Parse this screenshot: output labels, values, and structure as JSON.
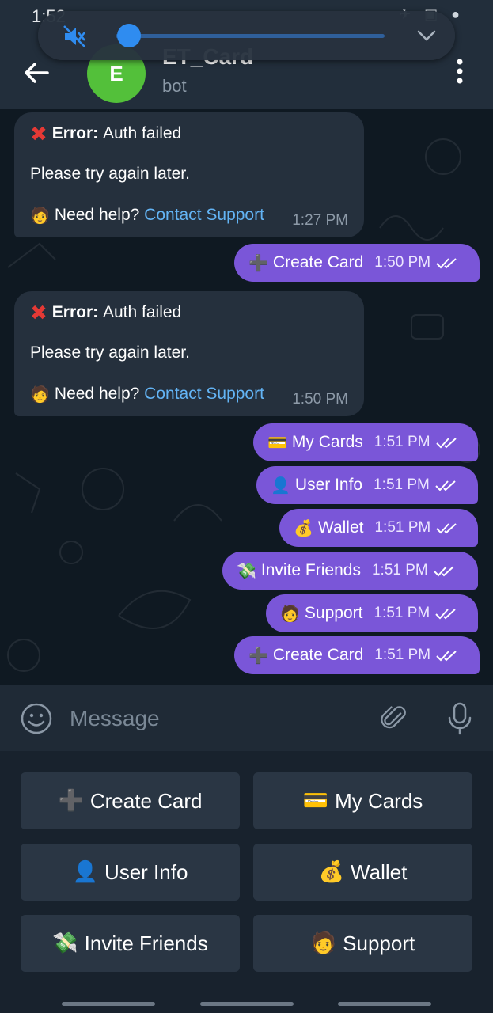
{
  "status_bar": {
    "time": "1:52",
    "icons": "✈ ▣ ●"
  },
  "volume": {
    "level": 0.05
  },
  "header": {
    "title": "ET_Card",
    "subtitle": "bot",
    "avatar_letter": "E"
  },
  "messages": {
    "incoming": [
      {
        "error_label": "Error:",
        "error_text": "Auth failed",
        "retry_text": "Please try again later.",
        "help_emoji": "🧑",
        "help_text": "Need help?",
        "link_text": "Contact Support",
        "time": "1:27 PM"
      },
      {
        "error_label": "Error:",
        "error_text": "Auth failed",
        "retry_text": "Please try again later.",
        "help_emoji": "🧑",
        "help_text": "Need help?",
        "link_text": "Contact Support",
        "time": "1:50 PM"
      }
    ],
    "outgoing": [
      {
        "emoji": "➕",
        "label": "Create Card",
        "time": "1:50 PM"
      },
      {
        "emoji": "💳",
        "label": "My Cards",
        "time": "1:51 PM"
      },
      {
        "emoji": "👤",
        "label": "User Info",
        "time": "1:51 PM"
      },
      {
        "emoji": "💰",
        "label": "Wallet",
        "time": "1:51 PM"
      },
      {
        "emoji": "💸",
        "label": "Invite Friends",
        "time": "1:51 PM"
      },
      {
        "emoji": "🧑",
        "label": "Support",
        "time": "1:51 PM"
      },
      {
        "emoji": "➕",
        "label": "Create Card",
        "time": "1:51 PM"
      }
    ]
  },
  "input": {
    "placeholder": "Message"
  },
  "keyboard": {
    "buttons": [
      {
        "emoji": "➕",
        "label": "Create Card"
      },
      {
        "emoji": "💳",
        "label": "My Cards"
      },
      {
        "emoji": "👤",
        "label": "User Info"
      },
      {
        "emoji": "💰",
        "label": "Wallet"
      },
      {
        "emoji": "💸",
        "label": "Invite Friends"
      },
      {
        "emoji": "🧑",
        "label": "Support"
      }
    ]
  },
  "colors": {
    "outgoing_bubble": "#7a56d8",
    "incoming_bubble": "#25303d",
    "link": "#63b4f5",
    "error": "#e53935",
    "avatar": "#53c03a"
  }
}
